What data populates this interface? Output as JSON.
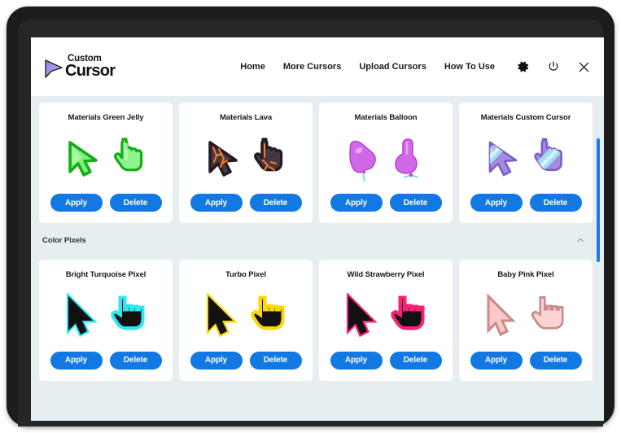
{
  "brand": {
    "logo_top": "Custom",
    "logo_bottom": "Cursor",
    "logo_icon": "cursor-arrow-logo-icon"
  },
  "header": {
    "nav": [
      {
        "label": "Home",
        "name": "nav-home"
      },
      {
        "label": "More Cursors",
        "name": "nav-more-cursors"
      },
      {
        "label": "Upload Cursors",
        "name": "nav-upload-cursors"
      },
      {
        "label": "How To Use",
        "name": "nav-how-to-use"
      }
    ],
    "actions": [
      {
        "name": "settings-gear-icon",
        "label": "Settings"
      },
      {
        "name": "power-icon",
        "label": "Power"
      },
      {
        "name": "close-icon",
        "label": "Close"
      }
    ]
  },
  "buttons": {
    "apply": "Apply",
    "delete": "Delete"
  },
  "colors": {
    "primary_button": "#1278e3",
    "page_background": "#e7eef2",
    "card_background": "#ffffff",
    "scrollbar": "#1a7ae8",
    "bezel": "#1c1c1c"
  },
  "sections": [
    {
      "name": "materials-section",
      "header": null,
      "cards": [
        {
          "title": "Materials Green Jelly",
          "style": "green-jelly",
          "arrow_fill": "#6ef06e",
          "arrow_shade": "#2fcf2f",
          "hand_fill": "#8df58d",
          "hand_shade": "#2fcf2f",
          "outline": "#13a813"
        },
        {
          "title": "Materials Lava",
          "style": "lava",
          "arrow_fill": "#4a3b45",
          "arrow_shade": "#2a1f27",
          "hand_fill": "#4a3b45",
          "hand_shade": "#2a1f27",
          "outline": "#ff7a18"
        },
        {
          "title": "Materials Balloon",
          "style": "balloon",
          "arrow_fill": "#d069e8",
          "arrow_shade": "#b845d4",
          "hand_fill": "#d069e8",
          "hand_shade": "#b845d4",
          "outline": "#6ed8f0"
        },
        {
          "title": "Materials Custom Cursor",
          "style": "custom-cursor",
          "arrow_fill": "#a58ae0",
          "arrow_shade": "#8b6fd1",
          "hand_fill": "#a58ae0",
          "hand_shade": "#8b6fd1",
          "outline": "#7fd5f0"
        }
      ]
    },
    {
      "name": "color-pixels-section",
      "header": {
        "label": "Color Pixels",
        "collapse_icon": "chevron-up-icon"
      },
      "cards": [
        {
          "title": "Bright Turquoise Pixel",
          "style": "pixel",
          "arrow_fill": "#111111",
          "arrow_shade": "#111111",
          "hand_fill": "#111111",
          "hand_shade": "#111111",
          "outline": "#2ce8f0"
        },
        {
          "title": "Turbo Pixel",
          "style": "pixel",
          "arrow_fill": "#111111",
          "arrow_shade": "#111111",
          "hand_fill": "#111111",
          "hand_shade": "#111111",
          "outline": "#fbd800"
        },
        {
          "title": "Wild Strawberry Pixel",
          "style": "pixel",
          "arrow_fill": "#111111",
          "arrow_shade": "#111111",
          "hand_fill": "#111111",
          "hand_shade": "#111111",
          "outline": "#ff1f7a"
        },
        {
          "title": "Baby Pink Pixel",
          "style": "pixel",
          "arrow_fill": "#fcc9c9",
          "arrow_shade": "#fcc9c9",
          "hand_fill": "#fcd3d3",
          "hand_shade": "#fcd3d3",
          "outline": "#c98b8b"
        }
      ]
    }
  ]
}
